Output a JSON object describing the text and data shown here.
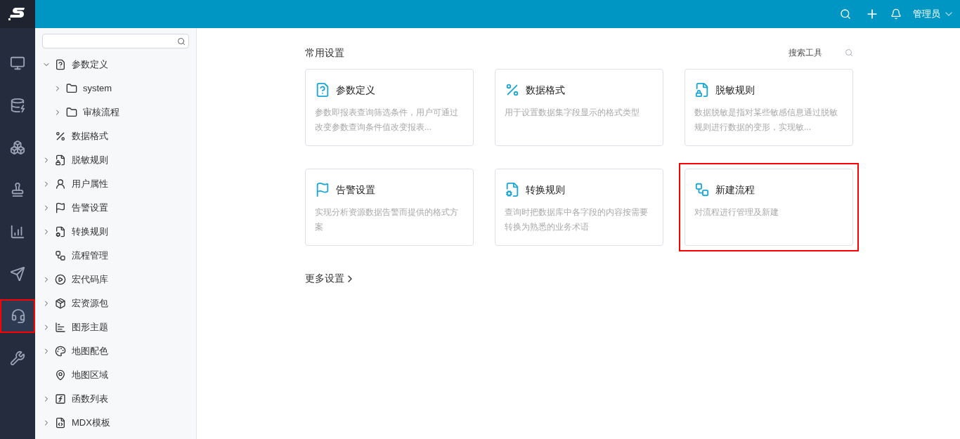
{
  "header": {
    "user": "管理员"
  },
  "rail": [
    {
      "kind": "monitor",
      "selected": false,
      "highlighted": false
    },
    {
      "kind": "database",
      "selected": false,
      "highlighted": false
    },
    {
      "kind": "boxes",
      "selected": false,
      "highlighted": false
    },
    {
      "kind": "stamp",
      "selected": false,
      "highlighted": false
    },
    {
      "kind": "chart",
      "selected": false,
      "highlighted": false
    },
    {
      "kind": "send",
      "selected": false,
      "highlighted": false
    },
    {
      "kind": "headset",
      "selected": true,
      "highlighted": true
    },
    {
      "kind": "tools",
      "selected": false,
      "highlighted": false
    }
  ],
  "tree": [
    {
      "label": "参数定义",
      "kind": "param",
      "expandable": true,
      "expanded": true,
      "children": [
        {
          "label": "system",
          "kind": "folder",
          "expandable": true,
          "expanded": false
        },
        {
          "label": "审核流程",
          "kind": "folder",
          "expandable": true,
          "expanded": false
        }
      ]
    },
    {
      "label": "数据格式",
      "kind": "format",
      "expandable": false,
      "expanded": false
    },
    {
      "label": "脱敏规则",
      "kind": "mask",
      "expandable": true,
      "expanded": false
    },
    {
      "label": "用户属性",
      "kind": "user",
      "expandable": true,
      "expanded": false
    },
    {
      "label": "告警设置",
      "kind": "flag",
      "expandable": true,
      "expanded": false
    },
    {
      "label": "转换规则",
      "kind": "convert",
      "expandable": true,
      "expanded": false
    },
    {
      "label": "流程管理",
      "kind": "flow",
      "expandable": false,
      "expanded": false
    },
    {
      "label": "宏代码库",
      "kind": "macro",
      "expandable": true,
      "expanded": false
    },
    {
      "label": "宏资源包",
      "kind": "package",
      "expandable": true,
      "expanded": false
    },
    {
      "label": "图形主题",
      "kind": "chart",
      "expandable": true,
      "expanded": false
    },
    {
      "label": "地图配色",
      "kind": "palette",
      "expandable": true,
      "expanded": false
    },
    {
      "label": "地图区域",
      "kind": "pin",
      "expandable": false,
      "expanded": false
    },
    {
      "label": "函数列表",
      "kind": "function",
      "expandable": true,
      "expanded": false
    },
    {
      "label": "MDX模板",
      "kind": "mdx",
      "expandable": true,
      "expanded": false
    }
  ],
  "main": {
    "title": "常用设置",
    "search_label": "搜索工具",
    "cards": [
      {
        "kind": "param",
        "title": "参数定义",
        "description": "参数即报表查询筛选条件，用户可通过改变参数查询条件值改变报表...",
        "highlighted": false
      },
      {
        "kind": "format",
        "title": "数据格式",
        "description": "用于设置数据集字段显示的格式类型",
        "highlighted": false
      },
      {
        "kind": "mask",
        "title": "脱敏规则",
        "description": "数据脱敏是指对某些敏感信息通过脱敏规则进行数据的变形，实现敏...",
        "highlighted": false
      },
      {
        "kind": "flag",
        "title": "告警设置",
        "description": "实现分析资源数据告警而提供的格式方案",
        "highlighted": false
      },
      {
        "kind": "convert",
        "title": "转换规则",
        "description": "查询时把数据库中各字段的内容按需要转换为熟悉的业务术语",
        "highlighted": false
      },
      {
        "kind": "flow",
        "title": "新建流程",
        "description": "对流程进行管理及新建",
        "highlighted": true
      }
    ],
    "more_link": "更多设置"
  }
}
